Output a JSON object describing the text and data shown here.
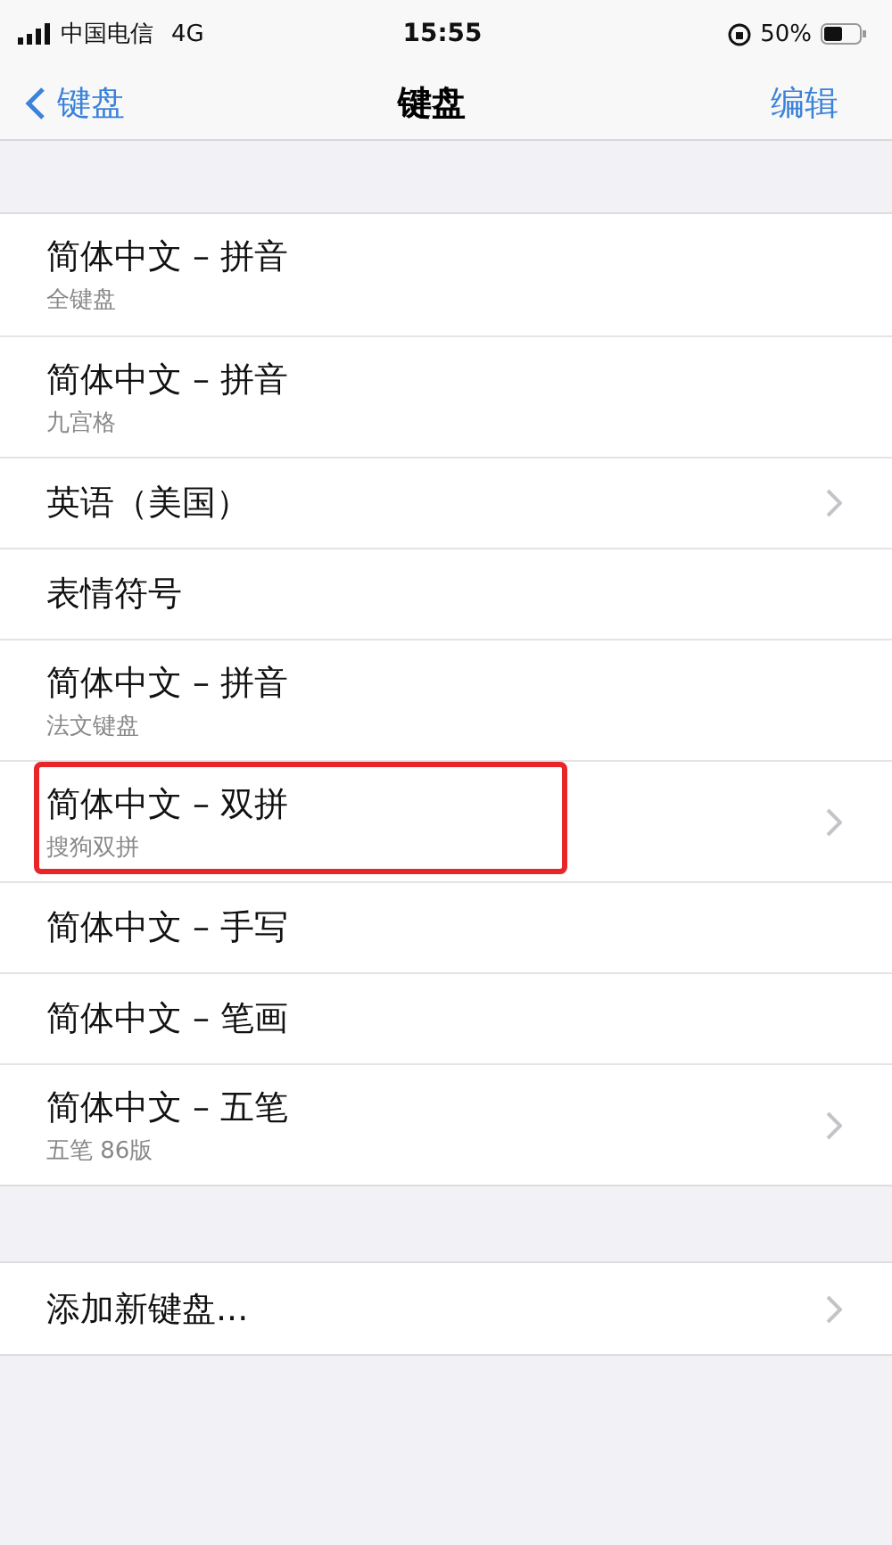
{
  "status_bar": {
    "carrier": "中国电信",
    "network": "4G",
    "time": "15:55",
    "battery": "50%"
  },
  "nav": {
    "back": "键盘",
    "title": "键盘",
    "action": "编辑"
  },
  "keyboards": [
    {
      "title": "简体中文 – 拼音",
      "subtitle": "全键盘",
      "chevron": false,
      "highlighted": false
    },
    {
      "title": "简体中文 – 拼音",
      "subtitle": "九宫格",
      "chevron": false,
      "highlighted": false
    },
    {
      "title": "英语（美国）",
      "chevron": true,
      "highlighted": false
    },
    {
      "title": "表情符号",
      "chevron": false,
      "highlighted": false
    },
    {
      "title": "简体中文 – 拼音",
      "subtitle": "法文键盘",
      "chevron": false,
      "highlighted": false
    },
    {
      "title": "简体中文 – 双拼",
      "subtitle": "搜狗双拼",
      "chevron": true,
      "highlighted": true
    },
    {
      "title": "简体中文 – 手写",
      "chevron": false,
      "highlighted": false
    },
    {
      "title": "简体中文 – 笔画",
      "chevron": false,
      "highlighted": false
    },
    {
      "title": "简体中文 – 五笔",
      "subtitle": "五笔 86版",
      "chevron": true,
      "highlighted": false
    }
  ],
  "add_keyboard": {
    "title": "添加新键盘...",
    "chevron": true
  }
}
